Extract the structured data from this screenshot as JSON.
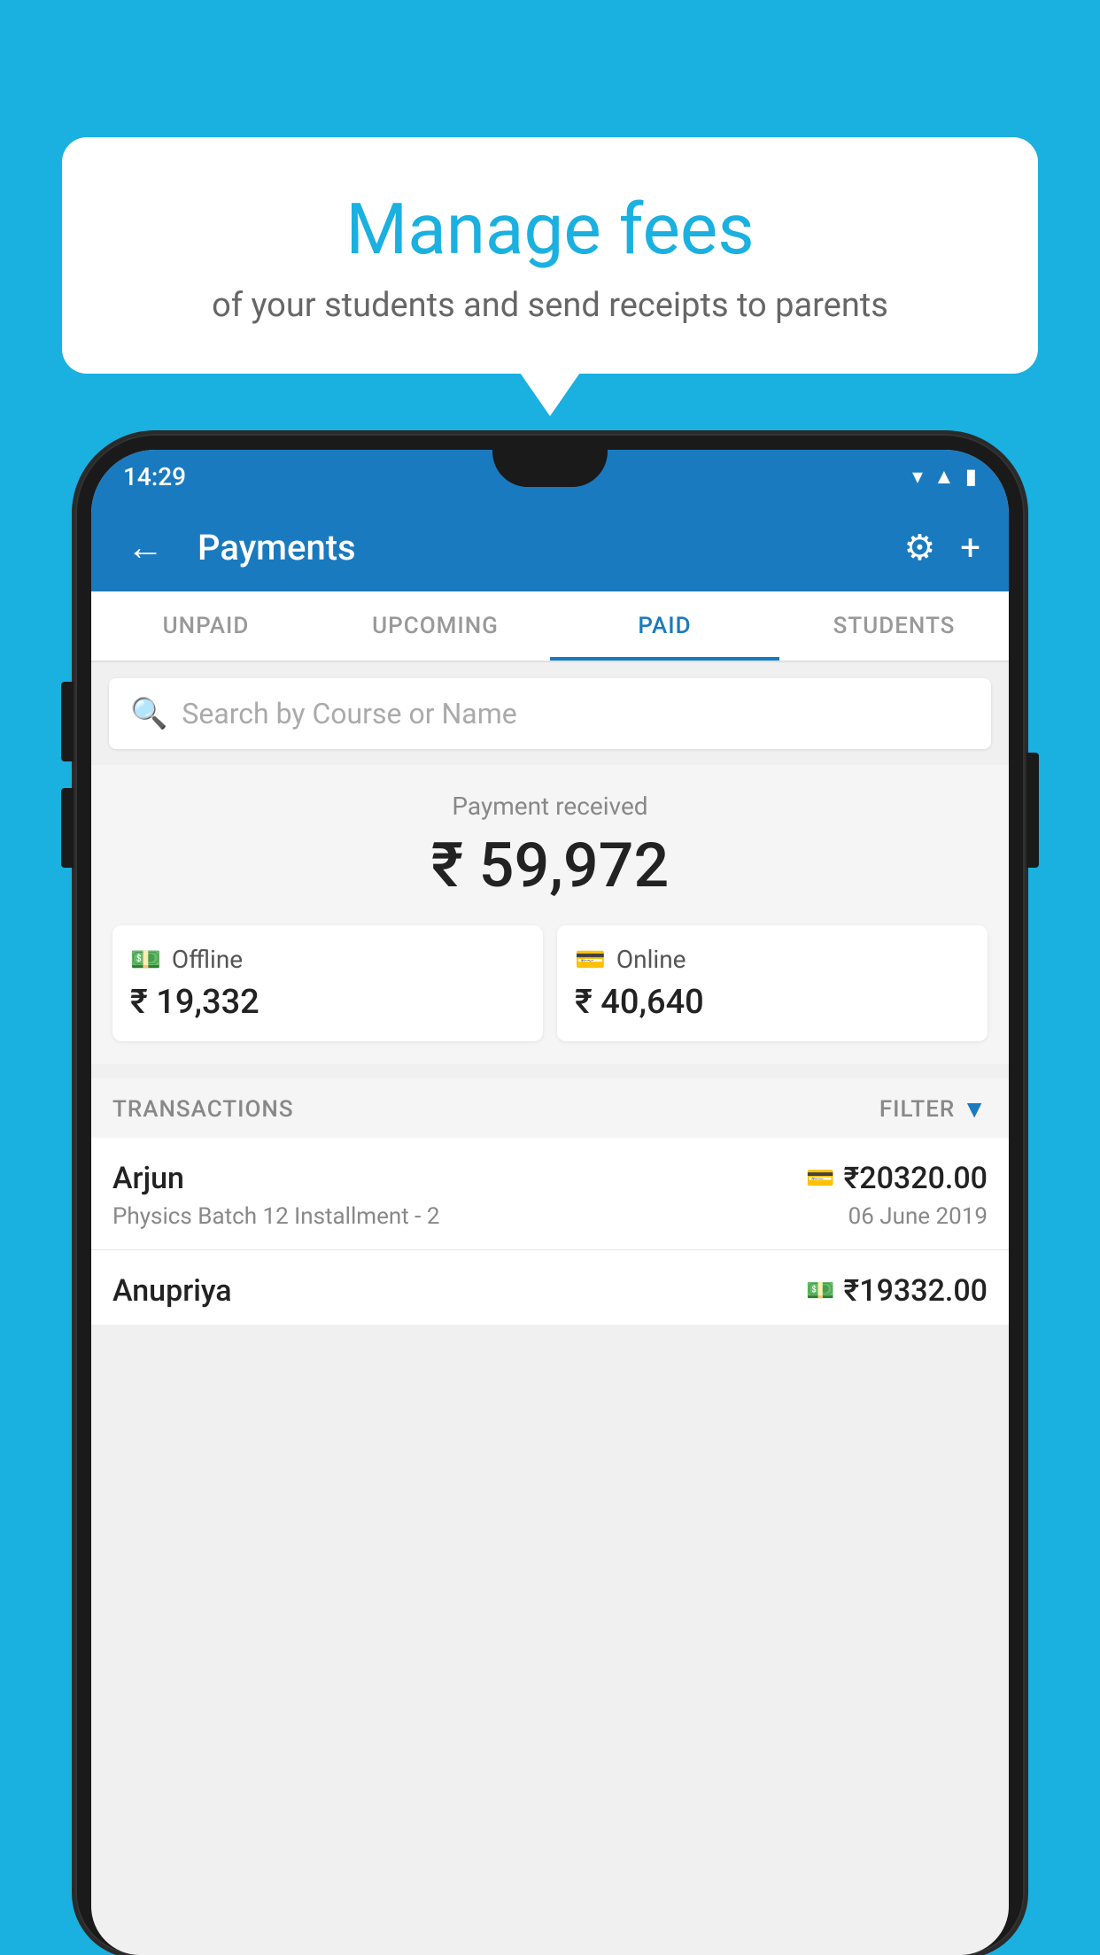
{
  "background_color": "#1ab0e0",
  "speech_bubble": {
    "title": "Manage fees",
    "subtitle": "of your students and send receipts to parents"
  },
  "status_bar": {
    "time": "14:29",
    "wifi": "▼",
    "signal": "▲",
    "battery": "▮"
  },
  "app_bar": {
    "title": "Payments",
    "back_label": "←",
    "gear_label": "⚙",
    "plus_label": "+"
  },
  "tabs": [
    {
      "id": "unpaid",
      "label": "UNPAID",
      "active": false
    },
    {
      "id": "upcoming",
      "label": "UPCOMING",
      "active": false
    },
    {
      "id": "paid",
      "label": "PAID",
      "active": true
    },
    {
      "id": "students",
      "label": "STUDENTS",
      "active": false
    }
  ],
  "search": {
    "placeholder": "Search by Course or Name"
  },
  "payment_summary": {
    "label": "Payment received",
    "amount": "₹ 59,972",
    "offline": {
      "label": "Offline",
      "amount": "₹ 19,332"
    },
    "online": {
      "label": "Online",
      "amount": "₹ 40,640"
    }
  },
  "transactions": {
    "section_label": "TRANSACTIONS",
    "filter_label": "FILTER",
    "rows": [
      {
        "name": "Arjun",
        "amount": "₹20320.00",
        "description": "Physics Batch 12 Installment - 2",
        "date": "06 June 2019",
        "icon": "card"
      },
      {
        "name": "Anupriya",
        "amount": "₹19332.00",
        "description": "",
        "date": "",
        "icon": "cash"
      }
    ]
  }
}
